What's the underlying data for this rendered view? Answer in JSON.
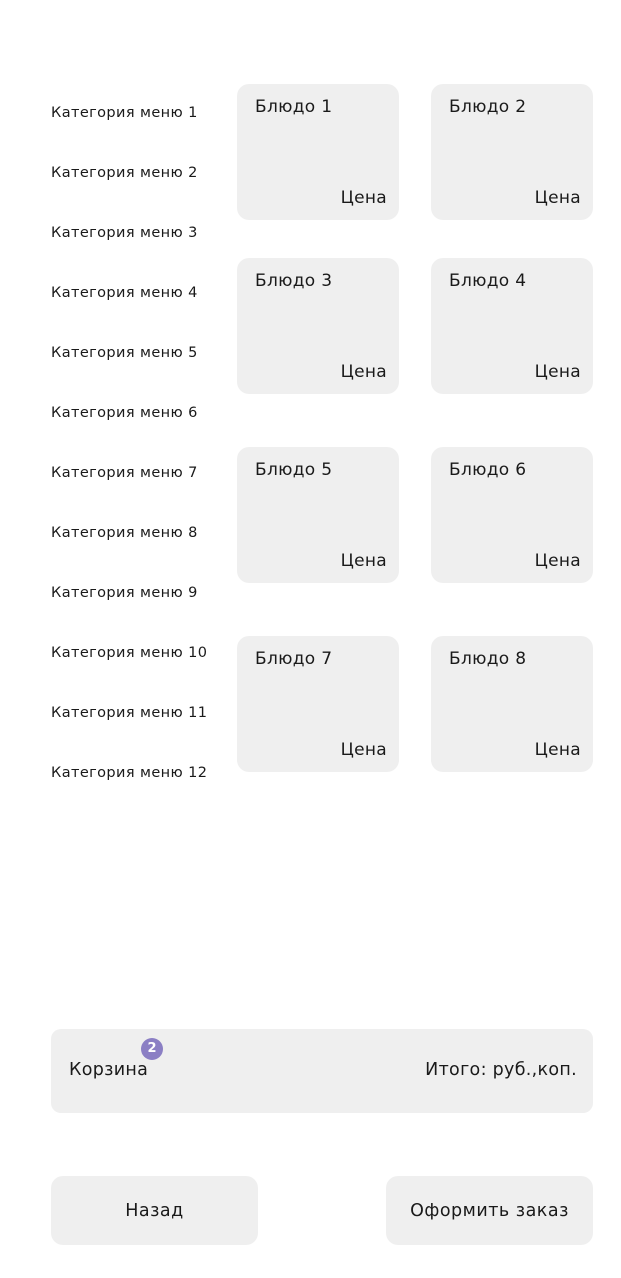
{
  "categories": [
    "Категория меню 1",
    "Категория меню 2",
    "Категория меню 3",
    "Категория меню 4",
    "Категория меню 5",
    "Категория меню 6",
    "Категория меню 7",
    "Категория меню 8",
    "Категория меню 9",
    "Категория меню 10",
    "Категория меню 11",
    "Категория меню 12"
  ],
  "dishes": [
    {
      "name": "Блюдо 1",
      "price": "Цена"
    },
    {
      "name": "Блюдо 2",
      "price": "Цена"
    },
    {
      "name": "Блюдо 3",
      "price": "Цена"
    },
    {
      "name": "Блюдо 4",
      "price": "Цена"
    },
    {
      "name": "Блюдо 5",
      "price": "Цена"
    },
    {
      "name": "Блюдо 6",
      "price": "Цена"
    },
    {
      "name": "Блюдо 7",
      "price": "Цена"
    },
    {
      "name": "Блюдо 8",
      "price": "Цена"
    }
  ],
  "cart": {
    "label": "Корзина",
    "badge_count": "2",
    "total": "Итого: руб.,коп."
  },
  "buttons": {
    "back": "Назад",
    "checkout": "Оформить заказ"
  },
  "colors": {
    "card_bg": "#efefef",
    "badge": "#8b7fc4"
  }
}
